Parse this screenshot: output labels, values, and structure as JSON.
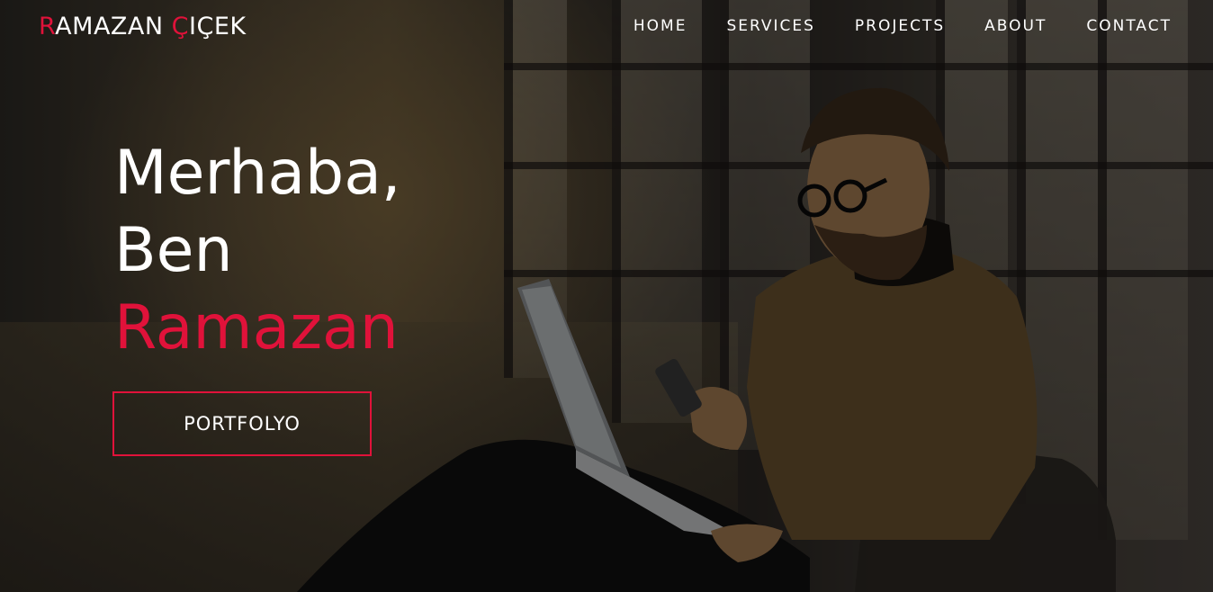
{
  "brand": {
    "first_letter": "R",
    "rest_first": "AMAZAN ",
    "second_first_letter": "Ç",
    "rest_second": "IÇEK"
  },
  "nav": {
    "items": [
      {
        "label": "HOME"
      },
      {
        "label": "SERVICES"
      },
      {
        "label": "PROJECTS"
      },
      {
        "label": "ABOUT"
      },
      {
        "label": "CONTACT"
      }
    ]
  },
  "hero": {
    "line1": "Merhaba,",
    "line2": "Ben",
    "line3": "Ramazan",
    "button_label": "PORTFOLYO"
  },
  "colors": {
    "accent": "#e0123a",
    "text": "#ffffff"
  }
}
